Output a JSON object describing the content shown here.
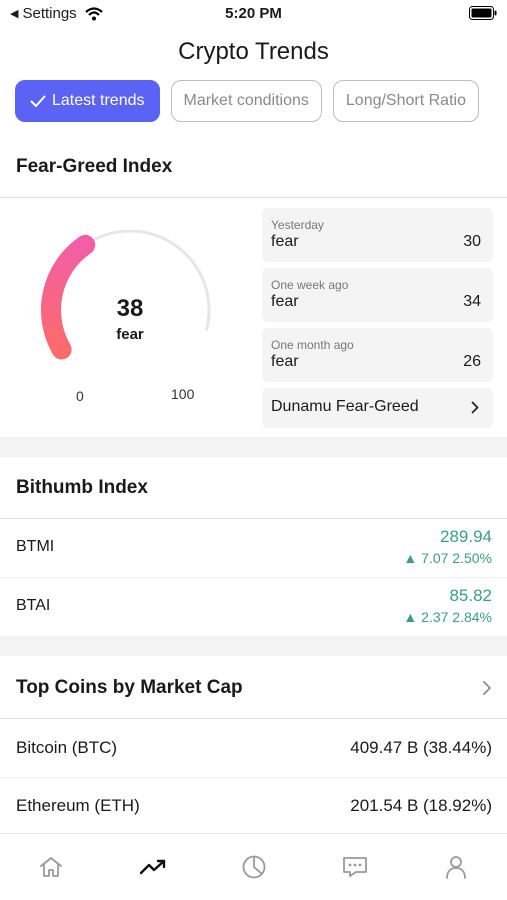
{
  "status_bar": {
    "back_label": "Settings",
    "time": "5:20 PM"
  },
  "page": {
    "title": "Crypto Trends"
  },
  "tabs": [
    {
      "label": "Latest trends",
      "active": true
    },
    {
      "label": "Market conditions",
      "active": false
    },
    {
      "label": "Long/Short Ratio",
      "active": false
    }
  ],
  "fear_greed": {
    "title": "Fear-Greed Index",
    "gauge": {
      "value": "38",
      "label": "fear",
      "min": "0",
      "max": "100",
      "level_percent": 38
    },
    "history": [
      {
        "when": "Yesterday",
        "level": "fear",
        "value": "30"
      },
      {
        "when": "One week ago",
        "level": "fear",
        "value": "34"
      },
      {
        "when": "One month ago",
        "level": "fear",
        "value": "26"
      }
    ],
    "link_label": "Dunamu Fear-Greed"
  },
  "bithumb": {
    "title": "Bithumb Index",
    "rows": [
      {
        "name": "BTMI",
        "value": "289.94",
        "change": "▲ 7.07  2.50%"
      },
      {
        "name": "BTAI",
        "value": "85.82",
        "change": "▲ 2.37  2.84%"
      }
    ]
  },
  "top_coins": {
    "title": "Top Coins by Market Cap",
    "rows": [
      {
        "name": "Bitcoin (BTC)",
        "value": "409.47 B (38.44%)"
      },
      {
        "name": "Ethereum (ETH)",
        "value": "201.54 B (18.92%)"
      }
    ]
  },
  "tab_bar": {
    "items": [
      {
        "icon": "home-icon"
      },
      {
        "icon": "trending-icon"
      },
      {
        "icon": "pie-chart-icon"
      },
      {
        "icon": "chat-icon"
      },
      {
        "icon": "user-icon"
      }
    ]
  },
  "colors": {
    "accent": "#5b63f5",
    "positive": "#3aa17a",
    "gauge_start": "#fb6b6b",
    "gauge_end": "#f25fa6"
  }
}
